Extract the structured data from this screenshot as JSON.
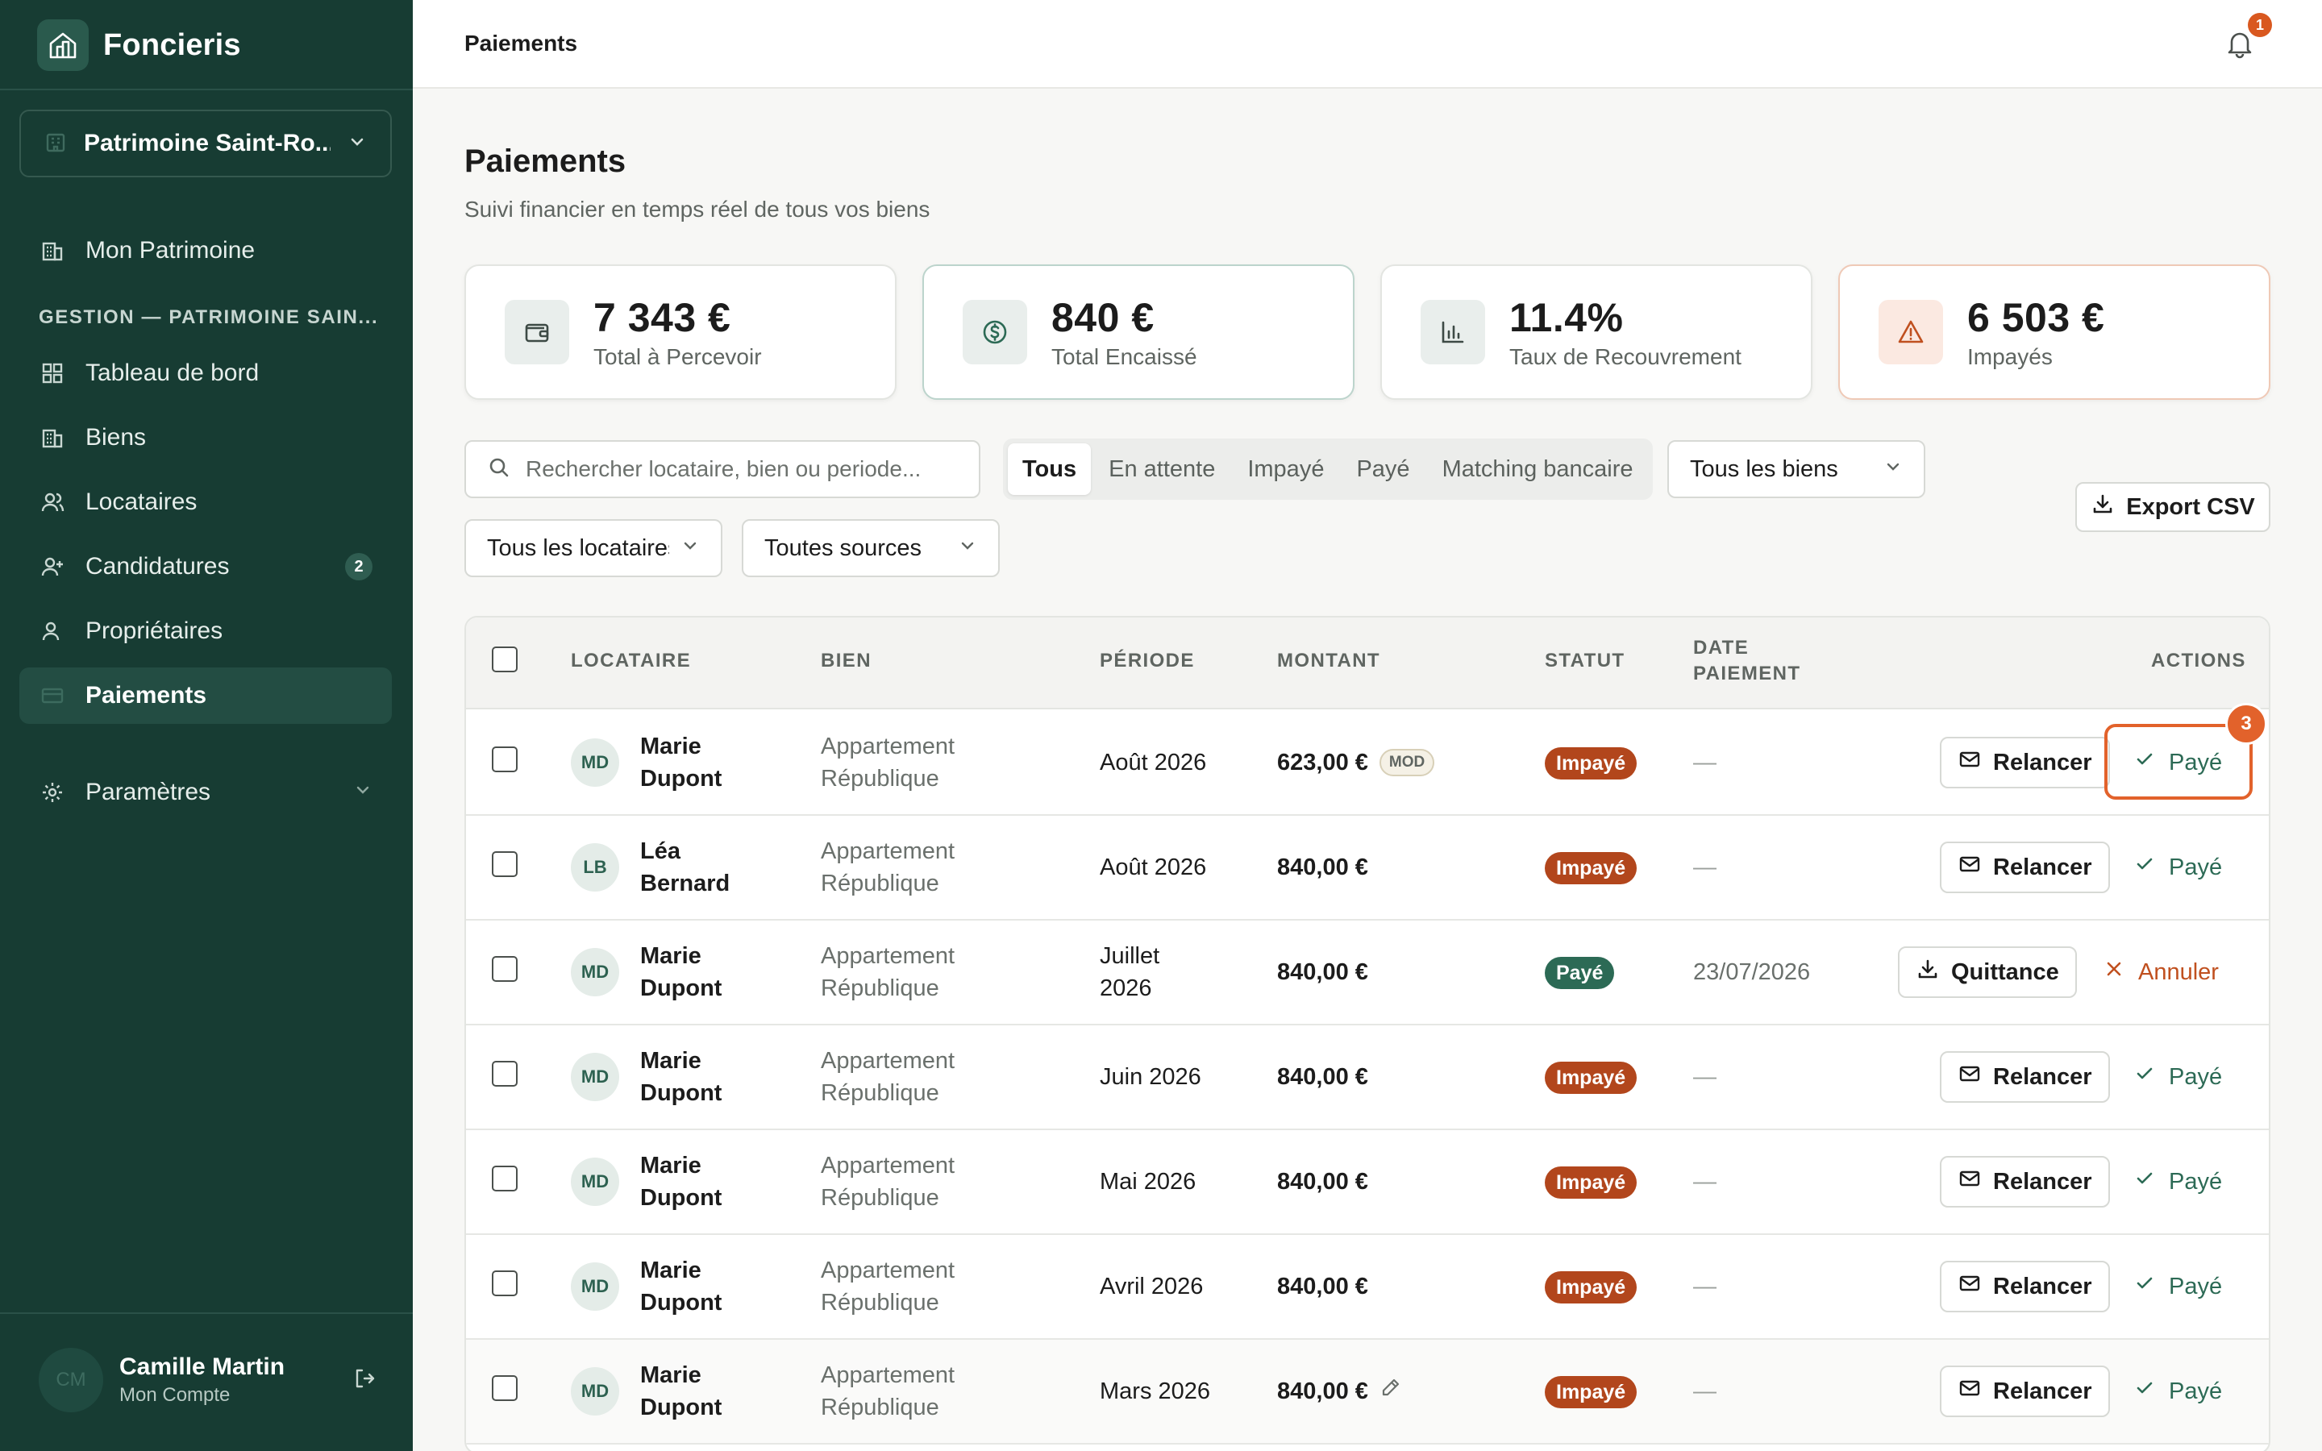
{
  "app": {
    "name": "Foncieris",
    "workspace": "Patrimoine Saint-Ro..."
  },
  "sidebar": {
    "top_item": "Mon Patrimoine",
    "section_title": "GESTION — PATRIMOINE SAIN...",
    "items": [
      {
        "label": "Tableau de bord",
        "icon": "dashboard-icon"
      },
      {
        "label": "Biens",
        "icon": "building-icon"
      },
      {
        "label": "Locataires",
        "icon": "users-icon"
      },
      {
        "label": "Candidatures",
        "icon": "user-plus-icon",
        "badge": "2"
      },
      {
        "label": "Propriétaires",
        "icon": "user-icon"
      },
      {
        "label": "Paiements",
        "icon": "card-icon",
        "active": true
      }
    ],
    "settings": "Paramètres",
    "user": {
      "initials": "CM",
      "name": "Camille Martin",
      "subtitle": "Mon Compte"
    }
  },
  "topbar": {
    "title": "Paiements",
    "notifications": "1"
  },
  "page": {
    "title": "Paiements",
    "subtitle": "Suivi financier en temps réel de tous vos biens"
  },
  "stats": [
    {
      "value": "7 343 €",
      "label": "Total à Percevoir",
      "icon": "wallet-icon"
    },
    {
      "value": "840 €",
      "label": "Total Encaissé",
      "icon": "dollar-circle-icon"
    },
    {
      "value": "11.4%",
      "label": "Taux de Recouvrement",
      "icon": "bar-chart-icon"
    },
    {
      "value": "6 503 €",
      "label": "Impayés",
      "icon": "warning-icon"
    }
  ],
  "filters": {
    "search_placeholder": "Rechercher locataire, bien ou periode...",
    "status_tabs": [
      "Tous",
      "En attente",
      "Impayé",
      "Payé",
      "Matching bancaire"
    ],
    "active_tab": "Tous",
    "biens": "Tous les biens",
    "locataires": "Tous les locataires",
    "sources": "Toutes sources",
    "export": "Export CSV"
  },
  "table": {
    "headers": {
      "locataire": "LOCATAIRE",
      "bien": "BIEN",
      "periode": "PÉRIODE",
      "montant": "MONTANT",
      "statut": "STATUT",
      "date_l1": "DATE",
      "date_l2": "PAIEMENT",
      "actions": "ACTIONS"
    },
    "rows": [
      {
        "initials": "MD",
        "first": "Marie",
        "last": "Dupont",
        "bien1": "Appartement",
        "bien2": "République",
        "periode1": "Août 2026",
        "periode2": "",
        "montant": "623,00 €",
        "tag": "MOD",
        "statut": "Impayé",
        "date": "—",
        "action1": "Relancer",
        "action2": "Payé"
      },
      {
        "initials": "LB",
        "first": "Léa",
        "last": "Bernard",
        "bien1": "Appartement",
        "bien2": "République",
        "periode1": "Août 2026",
        "periode2": "",
        "montant": "840,00 €",
        "tag": "",
        "statut": "Impayé",
        "date": "—",
        "action1": "Relancer",
        "action2": "Payé"
      },
      {
        "initials": "MD",
        "first": "Marie",
        "last": "Dupont",
        "bien1": "Appartement",
        "bien2": "République",
        "periode1": "Juillet",
        "periode2": "2026",
        "montant": "840,00 €",
        "tag": "",
        "statut": "Payé",
        "date": "23/07/2026",
        "action1": "Quittance",
        "action2": "Annuler"
      },
      {
        "initials": "MD",
        "first": "Marie",
        "last": "Dupont",
        "bien1": "Appartement",
        "bien2": "République",
        "periode1": "Juin 2026",
        "periode2": "",
        "montant": "840,00 €",
        "tag": "",
        "statut": "Impayé",
        "date": "—",
        "action1": "Relancer",
        "action2": "Payé"
      },
      {
        "initials": "MD",
        "first": "Marie",
        "last": "Dupont",
        "bien1": "Appartement",
        "bien2": "République",
        "periode1": "Mai 2026",
        "periode2": "",
        "montant": "840,00 €",
        "tag": "",
        "statut": "Impayé",
        "date": "—",
        "action1": "Relancer",
        "action2": "Payé"
      },
      {
        "initials": "MD",
        "first": "Marie",
        "last": "Dupont",
        "bien1": "Appartement",
        "bien2": "République",
        "periode1": "Avril 2026",
        "periode2": "",
        "montant": "840,00 €",
        "tag": "",
        "statut": "Impayé",
        "date": "—",
        "action1": "Relancer",
        "action2": "Payé"
      },
      {
        "initials": "MD",
        "first": "Marie",
        "last": "Dupont",
        "bien1": "Appartement",
        "bien2": "République",
        "periode1": "Mars 2026",
        "periode2": "",
        "montant": "840,00 €",
        "tag": "",
        "statut": "Impayé",
        "date": "—",
        "action1": "Relancer",
        "action2": "Payé"
      }
    ]
  },
  "callout": {
    "step": "3"
  },
  "colors": {
    "sidebar": "#173c33",
    "accent_green": "#2c6a55",
    "unpaid": "#b2461c",
    "highlight": "#e2622b"
  }
}
